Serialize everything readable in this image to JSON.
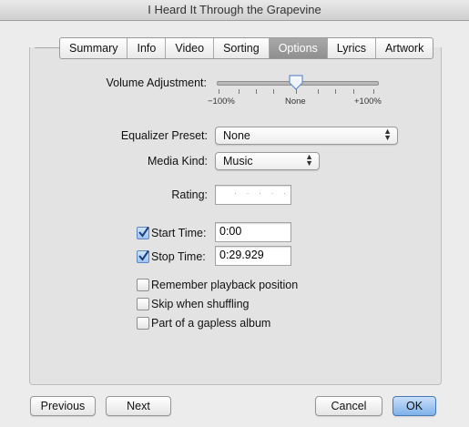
{
  "window": {
    "title": "I Heard It Through the Grapevine"
  },
  "tabs": [
    "Summary",
    "Info",
    "Video",
    "Sorting",
    "Options",
    "Lyrics",
    "Artwork"
  ],
  "active_tab": "Options",
  "volume": {
    "label": "Volume Adjustment:",
    "value_percent": 0,
    "ticks": {
      "min": "−100%",
      "mid": "None",
      "max": "+100%"
    }
  },
  "equalizer": {
    "label": "Equalizer Preset:",
    "value": "None"
  },
  "media_kind": {
    "label": "Media Kind:",
    "value": "Music"
  },
  "rating": {
    "label": "Rating:",
    "dots": "· · · · ·"
  },
  "start_time": {
    "label": "Start Time:",
    "value": "0:00",
    "checked": true
  },
  "stop_time": {
    "label": "Stop Time:",
    "value": "0:29.929",
    "checked": true
  },
  "options": [
    {
      "label": "Remember playback position",
      "checked": false
    },
    {
      "label": "Skip when shuffling",
      "checked": false
    },
    {
      "label": "Part of a gapless album",
      "checked": false
    }
  ],
  "buttons": {
    "previous": "Previous",
    "next": "Next",
    "cancel": "Cancel",
    "ok": "OK"
  }
}
